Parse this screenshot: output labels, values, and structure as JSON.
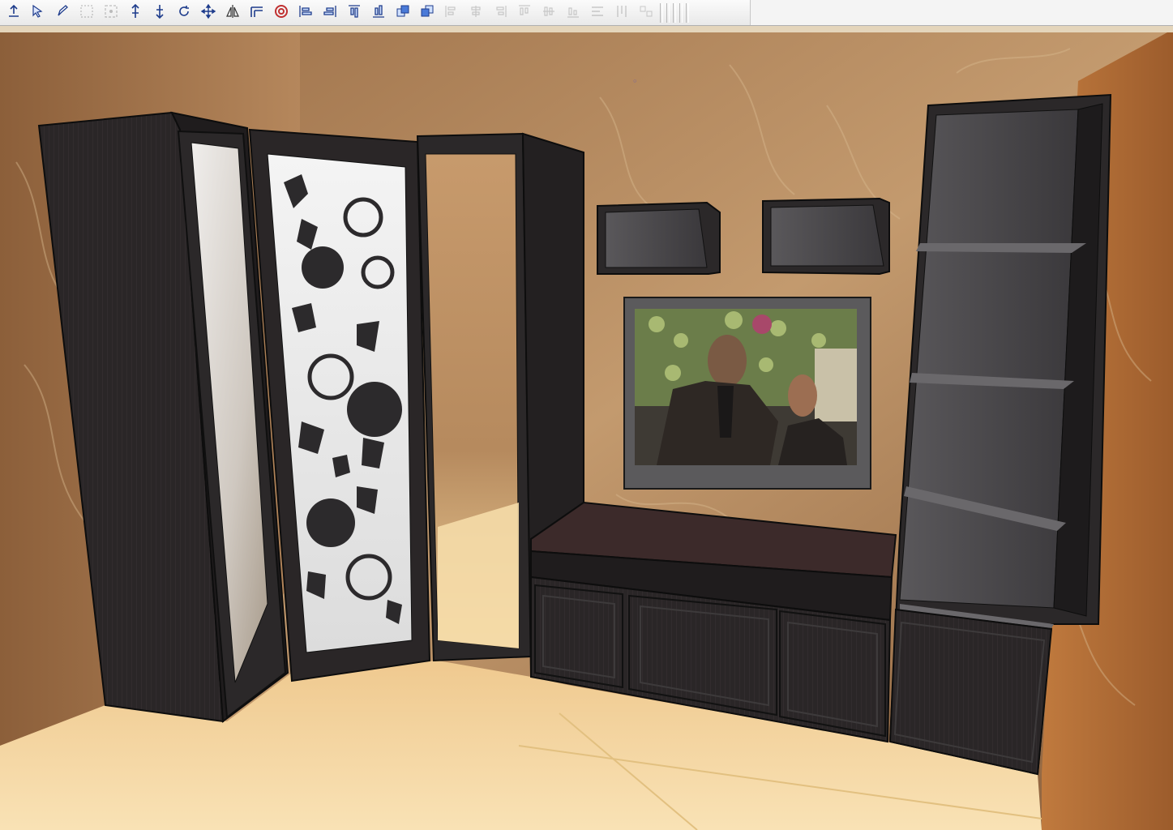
{
  "window": {
    "toolbar": {
      "groups": [
        [
          {
            "icon": "move-up-icon",
            "enabled": true
          },
          {
            "icon": "select-arrow-icon",
            "enabled": true
          },
          {
            "icon": "pencil-icon",
            "enabled": true
          }
        ],
        [
          {
            "icon": "frame-select-icon",
            "enabled": false
          },
          {
            "icon": "frame-select-dashed-icon",
            "enabled": false
          }
        ],
        [
          {
            "icon": "raise-up-icon",
            "enabled": true
          },
          {
            "icon": "lower-down-icon",
            "enabled": true
          },
          {
            "icon": "rotate-icon",
            "enabled": true
          },
          {
            "icon": "move-cross-icon",
            "enabled": true
          },
          {
            "icon": "mirror-icon",
            "enabled": true
          }
        ],
        [
          {
            "icon": "corner-profile-icon",
            "enabled": true
          },
          {
            "icon": "target-icon",
            "enabled": true
          }
        ],
        [
          {
            "icon": "align-left-icon",
            "enabled": true
          },
          {
            "icon": "align-right-icon",
            "enabled": true
          },
          {
            "icon": "align-top-icon",
            "enabled": true
          },
          {
            "icon": "align-bottom-icon",
            "enabled": true
          },
          {
            "icon": "bring-forward-icon",
            "enabled": true
          },
          {
            "icon": "send-backward-icon",
            "enabled": true
          }
        ],
        [
          {
            "icon": "distribute-left-icon",
            "enabled": false
          },
          {
            "icon": "distribute-center-icon",
            "enabled": false
          },
          {
            "icon": "distribute-right-icon",
            "enabled": false
          },
          {
            "icon": "distribute-top-icon",
            "enabled": false
          },
          {
            "icon": "distribute-middle-icon",
            "enabled": false
          },
          {
            "icon": "distribute-bottom-icon",
            "enabled": false
          },
          {
            "icon": "equal-width-icon",
            "enabled": false
          },
          {
            "icon": "equal-height-icon",
            "enabled": false
          },
          {
            "icon": "equal-size-icon",
            "enabled": false
          }
        ]
      ]
    },
    "scene": {
      "colors": {
        "wall": "#b98a5c",
        "wall_dark": "#8a5a34",
        "floor": "#f4d9a4",
        "furniture": "#2b2829",
        "furniture_edge": "#111111",
        "shelf_inner": "#4a484b",
        "mirror": "#d8d4cf",
        "ceiling": "#e3d3b8"
      },
      "objects": [
        "wardrobe-left",
        "mirror-door-left",
        "floral-glass-door",
        "mirror-door-right",
        "wall-shelf-left",
        "wall-shelf-right",
        "wall-tv",
        "tv-cabinet",
        "bookcase-right"
      ]
    }
  }
}
